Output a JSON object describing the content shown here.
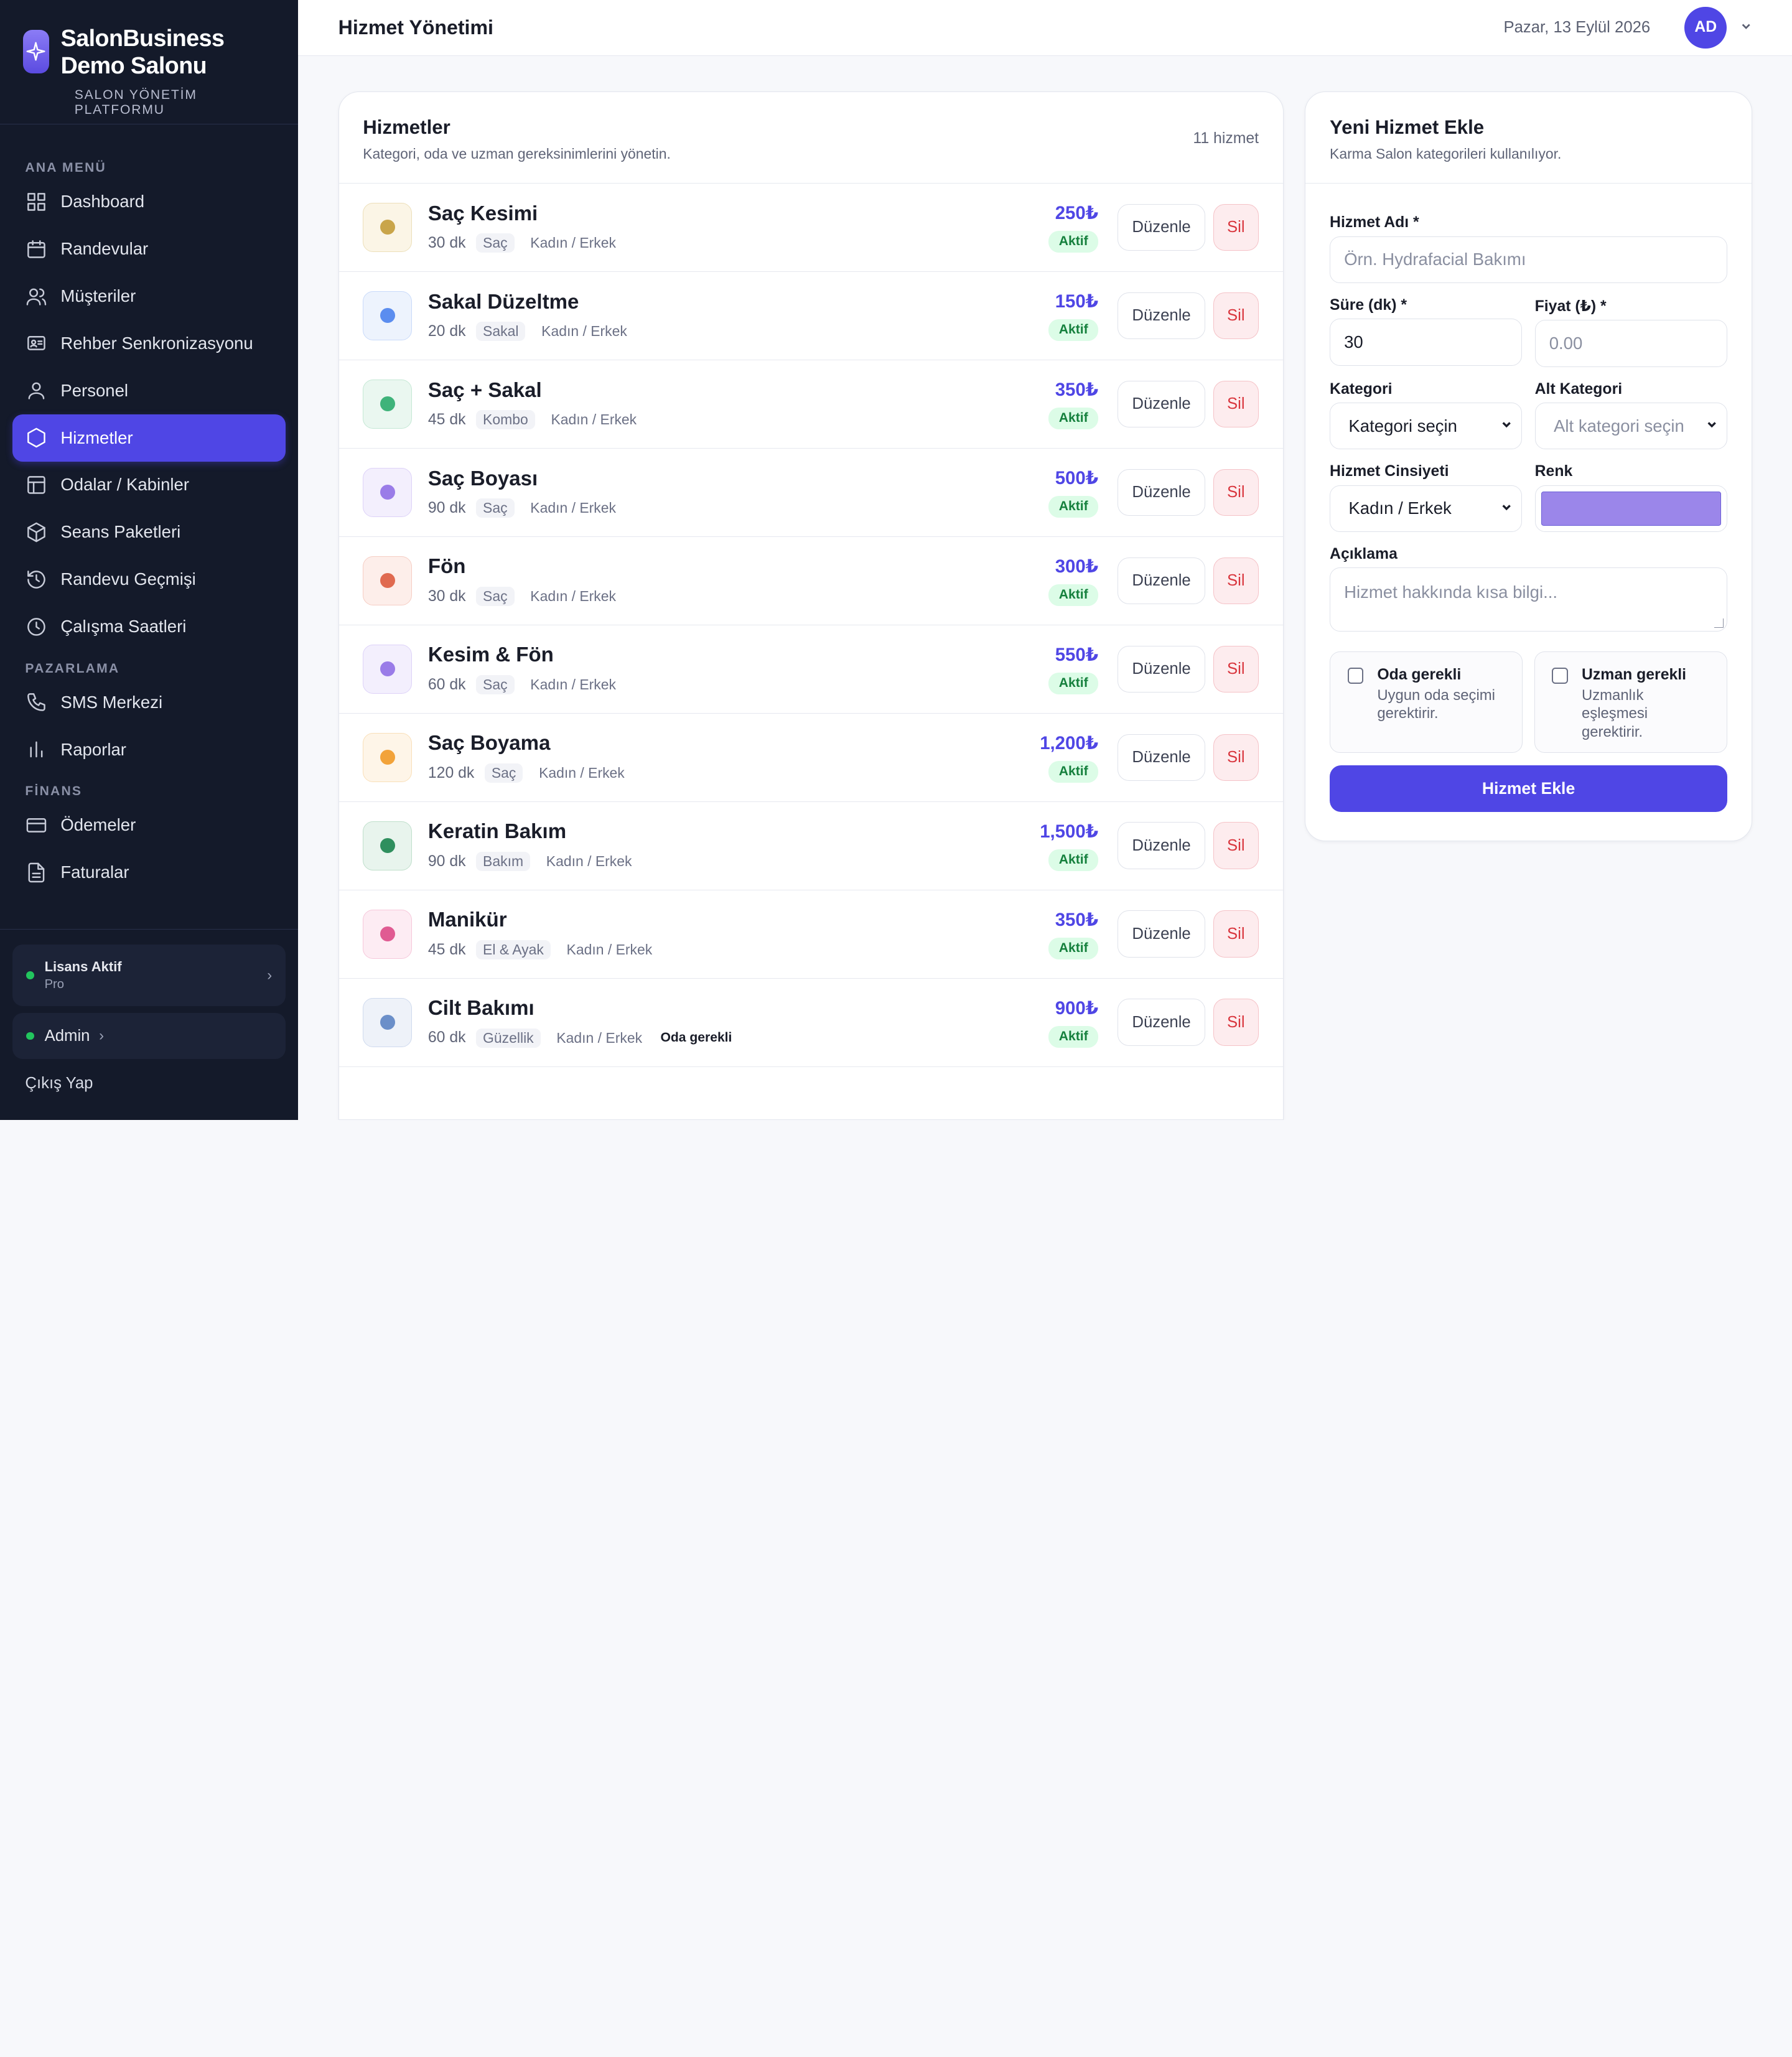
{
  "brand": {
    "name_line1": "SalonBusiness",
    "name_line2": "Demo Salonu",
    "subtitle": "SALON YÖNETİM PLATFORMU"
  },
  "nav": {
    "section_main": "ANA MENÜ",
    "section_marketing": "PAZARLAMA",
    "section_finance": "FİNANS",
    "main_items": [
      {
        "label": "Dashboard",
        "icon": "grid-icon"
      },
      {
        "label": "Randevular",
        "icon": "calendar-icon"
      },
      {
        "label": "Müşteriler",
        "icon": "users-icon"
      },
      {
        "label": "Rehber Senkronizasyonu",
        "icon": "contact-card-icon"
      },
      {
        "label": "Personel",
        "icon": "user-icon"
      },
      {
        "label": "Hizmetler",
        "icon": "hexagon-icon",
        "active": true
      },
      {
        "label": "Odalar / Kabinler",
        "icon": "layout-icon"
      },
      {
        "label": "Seans Paketleri",
        "icon": "package-icon"
      },
      {
        "label": "Randevu Geçmişi",
        "icon": "history-icon"
      },
      {
        "label": "Çalışma Saatleri",
        "icon": "clock-icon"
      }
    ],
    "marketing_items": [
      {
        "label": "SMS Merkezi",
        "icon": "phone-icon"
      },
      {
        "label": "Raporlar",
        "icon": "bar-chart-icon"
      }
    ],
    "finance_items": [
      {
        "label": "Ödemeler",
        "icon": "credit-card-icon"
      },
      {
        "label": "Faturalar",
        "icon": "file-icon"
      }
    ]
  },
  "footer": {
    "license_title": "Lisans Aktif",
    "license_plan": "Pro",
    "admin_label": "Admin",
    "logout_label": "Çıkış Yap"
  },
  "header": {
    "title": "Hizmet Yönetimi",
    "date": "Pazar, 13 Eylül 2026",
    "avatar_initials": "AD"
  },
  "services": {
    "title": "Hizmetler",
    "description": "Kategori, oda ve uzman gereksinimlerini yönetin.",
    "count": "11 hizmet",
    "edit_label": "Düzenle",
    "delete_label": "Sil",
    "items": [
      {
        "name": "Saç Kesimi",
        "duration": "30 dk",
        "category": "Saç",
        "gender": "Kadın / Erkek",
        "price": "250₺",
        "status": "Aktif",
        "color": "#c9a54a",
        "bg": "#fbf5e6",
        "border": "#ecdfb9"
      },
      {
        "name": "Sakal Düzeltme",
        "duration": "20 dk",
        "category": "Sakal",
        "gender": "Kadın / Erkek",
        "price": "150₺",
        "status": "Aktif",
        "color": "#5b8def",
        "bg": "#edf3fd",
        "border": "#c9dafa"
      },
      {
        "name": "Saç + Sakal",
        "duration": "45 dk",
        "category": "Kombo",
        "gender": "Kadın / Erkek",
        "price": "350₺",
        "status": "Aktif",
        "color": "#3fb37a",
        "bg": "#eaf7f0",
        "border": "#c4e8d4"
      },
      {
        "name": "Saç Boyası",
        "duration": "90 dk",
        "category": "Saç",
        "gender": "Kadın / Erkek",
        "price": "500₺",
        "status": "Aktif",
        "color": "#9a7ce8",
        "bg": "#f3effd",
        "border": "#ddd2f8"
      },
      {
        "name": "Fön",
        "duration": "30 dk",
        "category": "Saç",
        "gender": "Kadın / Erkek",
        "price": "300₺",
        "status": "Aktif",
        "color": "#e06a50",
        "bg": "#fdeeea",
        "border": "#f6cdc3"
      },
      {
        "name": "Kesim & Fön",
        "duration": "60 dk",
        "category": "Saç",
        "gender": "Kadın / Erkek",
        "price": "550₺",
        "status": "Aktif",
        "color": "#9a7ce8",
        "bg": "#f3effd",
        "border": "#ddd2f8"
      },
      {
        "name": "Saç Boyama",
        "duration": "120 dk",
        "category": "Saç",
        "gender": "Kadın / Erkek",
        "price": "1,200₺",
        "status": "Aktif",
        "color": "#f2a33a",
        "bg": "#fef5e8",
        "border": "#f9dfb8"
      },
      {
        "name": "Keratin Bakım",
        "duration": "90 dk",
        "category": "Bakım",
        "gender": "Kadın / Erkek",
        "price": "1,500₺",
        "status": "Aktif",
        "color": "#2f8f5e",
        "bg": "#e8f4ed",
        "border": "#bfdfcb"
      },
      {
        "name": "Manikür",
        "duration": "45 dk",
        "category": "El & Ayak",
        "gender": "Kadın / Erkek",
        "price": "350₺",
        "status": "Aktif",
        "color": "#e05b92",
        "bg": "#fdecf3",
        "border": "#f6c7da"
      },
      {
        "name": "Cilt Bakımı",
        "duration": "60 dk",
        "category": "Güzellik",
        "gender": "Kadın / Erkek",
        "price": "900₺",
        "status": "Aktif",
        "color": "#6b8fc9",
        "bg": "#eef2f9",
        "border": "#cfdaee",
        "extra": "Oda gerekli"
      }
    ]
  },
  "form": {
    "title": "Yeni Hizmet Ekle",
    "description": "Karma Salon kategorileri kullanılıyor.",
    "name_label": "Hizmet Adı *",
    "name_placeholder": "Örn. Hydrafacial Bakımı",
    "duration_label": "Süre (dk) *",
    "duration_value": "30",
    "price_label": "Fiyat (₺) *",
    "price_placeholder": "0.00",
    "category_label": "Kategori",
    "category_value": "Kategori seçin",
    "subcategory_label": "Alt Kategori",
    "subcategory_value": "Alt kategori seçin",
    "gender_label": "Hizmet Cinsiyeti",
    "gender_value": "Kadın / Erkek",
    "color_label": "Renk",
    "color_value": "#9b86ea",
    "desc_label": "Açıklama",
    "desc_placeholder": "Hizmet hakkında kısa bilgi...",
    "room_title": "Oda gerekli",
    "room_desc": "Uygun oda seçimi gerektirir.",
    "expert_title": "Uzman gerekli",
    "expert_desc": "Uzmanlık eşleşmesi gerektirir.",
    "submit_label": "Hizmet Ekle"
  }
}
